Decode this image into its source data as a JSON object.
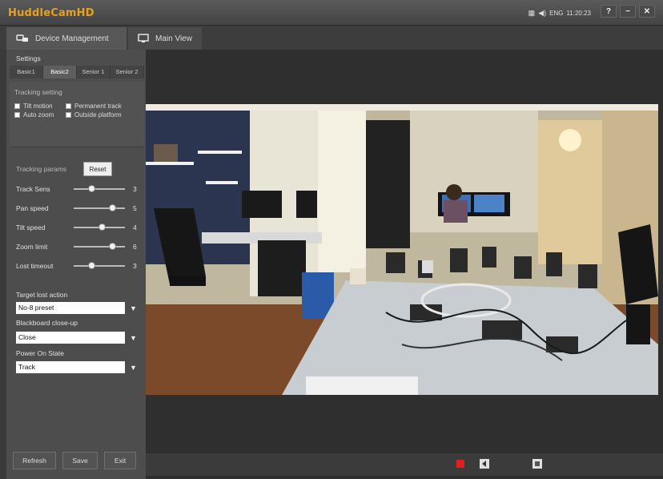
{
  "app": {
    "title": "HuddleCamHD"
  },
  "tray": {
    "icons": [
      "network-icon",
      "volume-icon"
    ],
    "lang": "ENG",
    "time": "11:20:23"
  },
  "window": {
    "help": "?",
    "minimize": "−",
    "close": "✕"
  },
  "tabs": [
    {
      "label": "Device Management",
      "icon": "devices-icon",
      "active": true
    },
    {
      "label": "Main View",
      "icon": "monitor-icon",
      "active": false
    }
  ],
  "sidebar": {
    "settings_label": "Settings",
    "subtabs": [
      {
        "label": "Basic1",
        "active": false
      },
      {
        "label": "Basic2",
        "active": true
      },
      {
        "label": "Senior 1",
        "active": false
      },
      {
        "label": "Senior 2",
        "active": false
      }
    ],
    "tracking_setting": {
      "title": "Tracking setting",
      "options": [
        {
          "label": "Tilt motion",
          "checked": false
        },
        {
          "label": "Permanent track",
          "checked": false
        },
        {
          "label": "Auto zoom",
          "checked": false
        },
        {
          "label": "Outside platform",
          "checked": false
        }
      ]
    },
    "tracking_params": {
      "title": "Tracking params",
      "reset_label": "Reset",
      "sliders": [
        {
          "label": "Track Sens",
          "value": "3",
          "fraction": 0.35
        },
        {
          "label": "Pan speed",
          "value": "5",
          "fraction": 0.75
        },
        {
          "label": "Tilt speed",
          "value": "4",
          "fraction": 0.55
        },
        {
          "label": "Zoom limit",
          "value": "6",
          "fraction": 0.75
        },
        {
          "label": "Lost timeout",
          "value": "3",
          "fraction": 0.35
        }
      ]
    },
    "dropdowns": [
      {
        "label": "Target lost action",
        "value": "No-8 preset"
      },
      {
        "label": "Blackboard close-up",
        "value": "Close"
      },
      {
        "label": "Power On State",
        "value": "Track"
      }
    ],
    "buttons": {
      "refresh": "Refresh",
      "save": "Save",
      "exit": "Exit"
    }
  },
  "player": {
    "record_color": "#e02020",
    "controls": [
      "record-icon",
      "prev-icon",
      "stop-icon"
    ]
  }
}
